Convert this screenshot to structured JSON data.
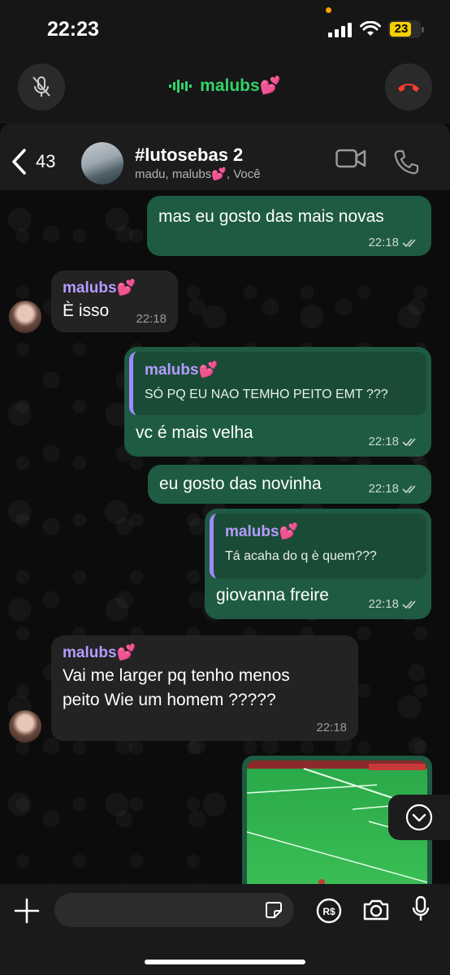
{
  "status_bar": {
    "time": "22:23",
    "battery": "23",
    "icons": [
      "orange-dot-indicator",
      "signal-icon",
      "wifi-icon",
      "battery-icon"
    ]
  },
  "call_bar": {
    "name": "malubs💕",
    "color": "#32d26a",
    "icons": [
      "mic-off-icon",
      "audio-wave-icon",
      "end-call-icon"
    ]
  },
  "header": {
    "back_count": "43",
    "title": "#lutosebas 2",
    "subtitle": "madu, malubs💕, Você",
    "icons": [
      "chevron-left-icon",
      "video-camera-icon",
      "phone-icon"
    ]
  },
  "messages": [
    {
      "dir": "out",
      "text": "mas eu gosto das mais novas",
      "time": "22:18",
      "status": "read"
    },
    {
      "dir": "in",
      "sender": "malubs💕",
      "text": "È isso",
      "time": "22:18"
    },
    {
      "dir": "out",
      "quote_name": "malubs💕",
      "quote_text": "SÓ PQ EU NAO TEMHO PEITO EMT ???",
      "text": "vc é mais velha",
      "time": "22:18",
      "status": "read"
    },
    {
      "dir": "out",
      "text": "eu gosto das novinha",
      "time": "22:18",
      "status": "read"
    },
    {
      "dir": "out",
      "quote_name": "malubs💕",
      "quote_text": "Tá acaha do q è quem???",
      "text": "giovanna freire",
      "time": "22:18",
      "status": "read"
    },
    {
      "dir": "in",
      "sender": "malubs💕",
      "lines": [
        "Vai me larger pq tenho menos",
        "peito Wie um homem ?????"
      ],
      "time": "22:18"
    },
    {
      "dir": "out",
      "type": "image",
      "description_icon": "soccer-pitch-image"
    }
  ],
  "input_bar": {
    "icons": [
      "plus-icon",
      "sticker-icon",
      "payment-icon",
      "camera-icon",
      "mic-icon"
    ]
  },
  "colors": {
    "outgoing_bubble": "#1e5b42",
    "incoming_bubble": "#232323",
    "sender_name": "#b49cff",
    "quote_bar": "#9d89ff"
  }
}
